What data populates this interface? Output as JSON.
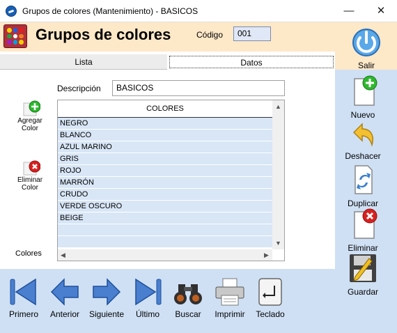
{
  "window": {
    "title": "Grupos de colores (Mantenimiento) - BASICOS",
    "minimize_glyph": "—",
    "close_glyph": "✕"
  },
  "header": {
    "title": "Grupos de colores",
    "code_label": "Código",
    "code_value": "001"
  },
  "tabs": [
    {
      "label": "Lista",
      "active": false
    },
    {
      "label": "Datos",
      "active": true
    }
  ],
  "form": {
    "description_label": "Descripción",
    "description_value": "BASICOS"
  },
  "side_actions": {
    "add_color": "Agregar Color",
    "delete_color": "Eliminar Color",
    "colors_label": "Colores"
  },
  "grid": {
    "column_header": "COLORES",
    "rows": [
      "NEGRO",
      "BLANCO",
      "AZUL MARINO",
      "GRIS",
      "ROJO",
      "MARRÓN",
      "CRUDO",
      "VERDE OSCURO",
      "BEIGE",
      "",
      ""
    ]
  },
  "right_toolbar": {
    "exit": "Salir",
    "new": "Nuevo",
    "undo": "Deshacer",
    "duplicate": "Duplicar",
    "delete": "Eliminar",
    "save": "Guardar"
  },
  "bottom_toolbar": {
    "first": "Primero",
    "previous": "Anterior",
    "next": "Siguiente",
    "last": "Último",
    "search": "Buscar",
    "print": "Imprimir",
    "keyboard": "Teclado"
  },
  "colors": {
    "header_bg": "#fde8c8",
    "toolbar_bg": "#cfe0f4",
    "row_bg": "#d8e6f6",
    "nav_blue": "#4a7fd0"
  }
}
